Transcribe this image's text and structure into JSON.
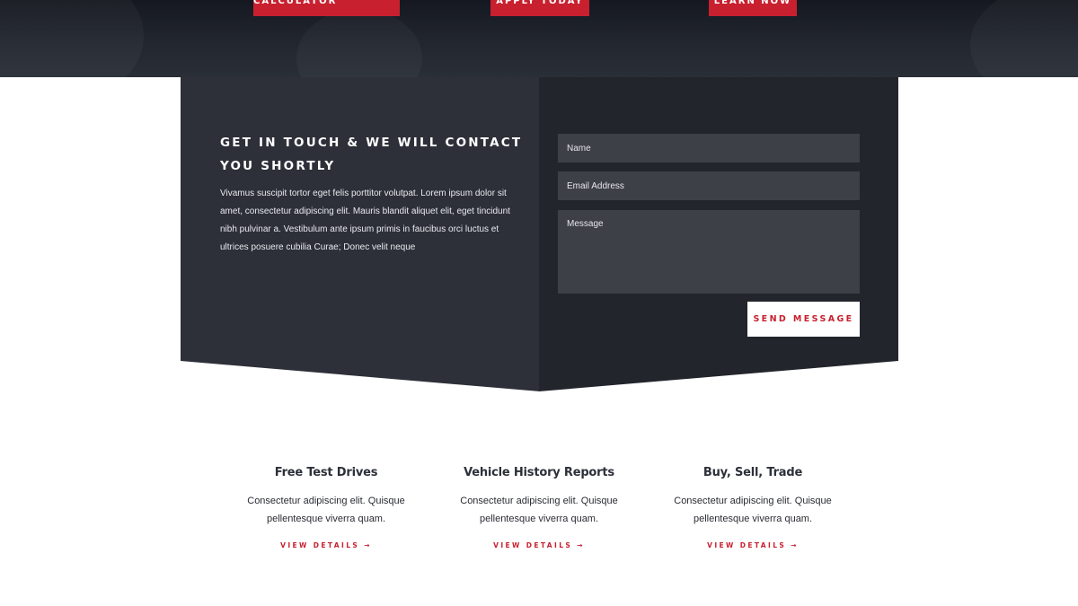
{
  "hero": {
    "buttons": [
      {
        "label": "PAYMENT CALCULATOR"
      },
      {
        "label": "APPLY TODAY"
      },
      {
        "label": "LEARN NOW"
      }
    ]
  },
  "contact": {
    "heading": "GET IN TOUCH & WE WILL CONTACT YOU SHORTLY",
    "text": "Vivamus suscipit tortor eget felis porttitor volutpat. Lorem ipsum dolor sit amet, consectetur adipiscing elit. Mauris blandit aliquet elit, eget tincidunt nibh pulvinar a. Vestibulum ante ipsum primis in faucibus orci luctus et ultrices posuere cubilia Curae; Donec velit neque",
    "form": {
      "name_placeholder": "Name",
      "email_placeholder": "Email Address",
      "message_placeholder": "Message",
      "submit_label": "SEND MESSAGE"
    }
  },
  "features": [
    {
      "title": "Free Test Drives",
      "text": "Consectetur adipiscing elit. Quisque pellentesque viverra quam.",
      "link": "VIEW DETAILS →"
    },
    {
      "title": "Vehicle History Reports",
      "text": "Consectetur adipiscing elit. Quisque pellentesque viverra quam.",
      "link": "VIEW DETAILS →"
    },
    {
      "title": "Buy, Sell, Trade",
      "text": "Consectetur adipiscing elit. Quisque pellentesque viverra quam.",
      "link": "VIEW DETAILS →"
    }
  ],
  "colors": {
    "accent": "#c8202f",
    "panel_dark": "#2d3039",
    "panel_darker": "#22252c",
    "field_bg": "#3e4048"
  }
}
